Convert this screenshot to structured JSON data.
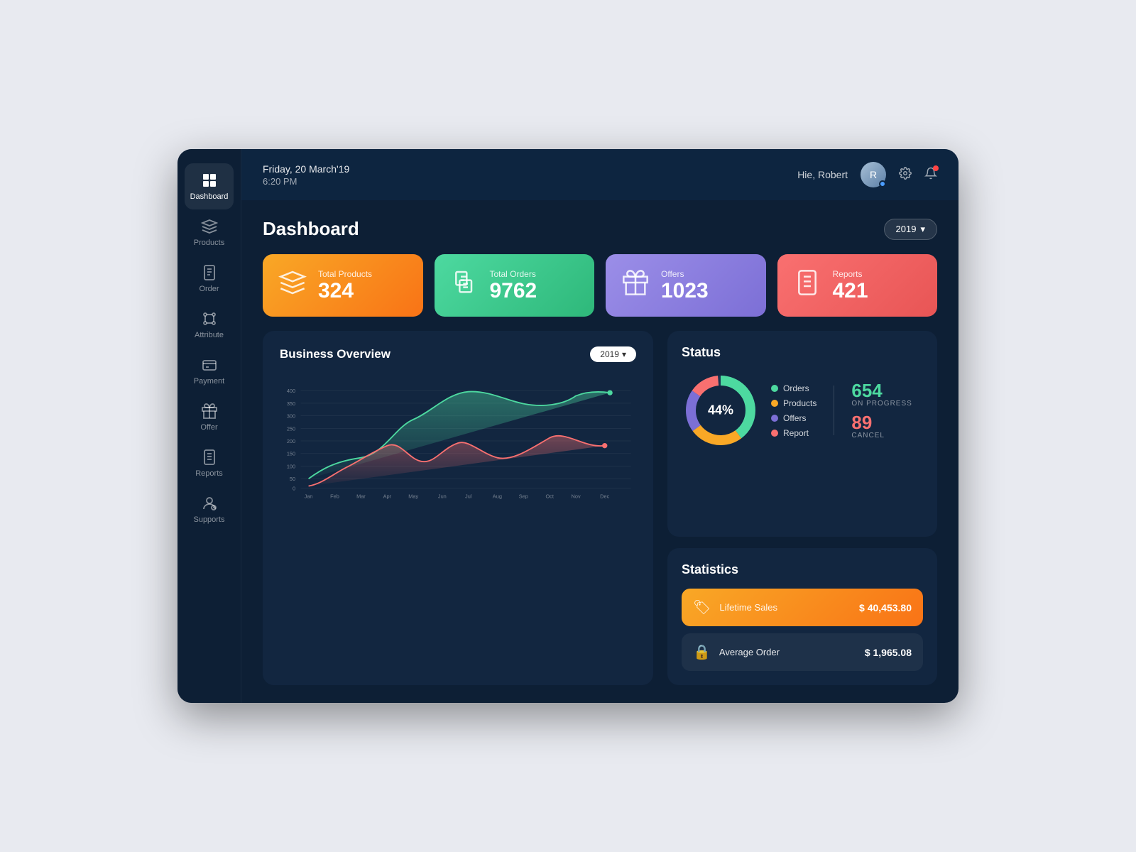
{
  "app": {
    "title": "Dashboard"
  },
  "header": {
    "date": "Friday, 20 March'19",
    "time": "6:20 PM",
    "username": "Hie, Robert",
    "avatar_initials": "R"
  },
  "dashboard": {
    "title": "Dashboard",
    "year_selector": "2019",
    "year_dropdown_icon": "▾"
  },
  "stat_cards": [
    {
      "label": "Total Products",
      "value": "324",
      "type": "orange"
    },
    {
      "label": "Total Orders",
      "value": "9762",
      "type": "green"
    },
    {
      "label": "Offers",
      "value": "1023",
      "type": "purple"
    },
    {
      "label": "Reports",
      "value": "421",
      "type": "red"
    }
  ],
  "chart": {
    "title": "Business Overview",
    "year": "2019",
    "y_labels": [
      "400",
      "350",
      "300",
      "250",
      "200",
      "150",
      "100",
      "50",
      "0"
    ],
    "x_labels": [
      "Jan",
      "Feb",
      "Mar",
      "Apr",
      "May",
      "Jun",
      "Jul",
      "Aug",
      "Sep",
      "Oct",
      "Nov",
      "Dec"
    ]
  },
  "status": {
    "title": "Status",
    "donut_percent": "44%",
    "legend": [
      {
        "color": "#4dd9a0",
        "label": "Orders"
      },
      {
        "color": "#f9a826",
        "label": "Products"
      },
      {
        "color": "#7c6fd6",
        "label": "Offers"
      },
      {
        "color": "#f97070",
        "label": "Report"
      }
    ],
    "on_progress_value": "654",
    "on_progress_label": "ON PROGRESS",
    "cancel_value": "89",
    "cancel_label": "CANCEL"
  },
  "statistics": {
    "title": "Statistics",
    "items": [
      {
        "icon": "🏷",
        "label": "Lifetime Sales",
        "value": "$ 40,453.80",
        "style": "orange"
      },
      {
        "icon": "🔒",
        "label": "Average Order",
        "value": "$ 1,965.08",
        "style": "dark"
      }
    ]
  },
  "sidebar": {
    "items": [
      {
        "id": "dashboard",
        "label": "Dashboard",
        "active": true
      },
      {
        "id": "products",
        "label": "Products",
        "active": false
      },
      {
        "id": "order",
        "label": "Order",
        "active": false
      },
      {
        "id": "attribute",
        "label": "Attribute",
        "active": false
      },
      {
        "id": "payment",
        "label": "Payment",
        "active": false
      },
      {
        "id": "offer",
        "label": "Offer",
        "active": false
      },
      {
        "id": "reports",
        "label": "Reports",
        "active": false
      },
      {
        "id": "supports",
        "label": "Supports",
        "active": false
      }
    ]
  }
}
